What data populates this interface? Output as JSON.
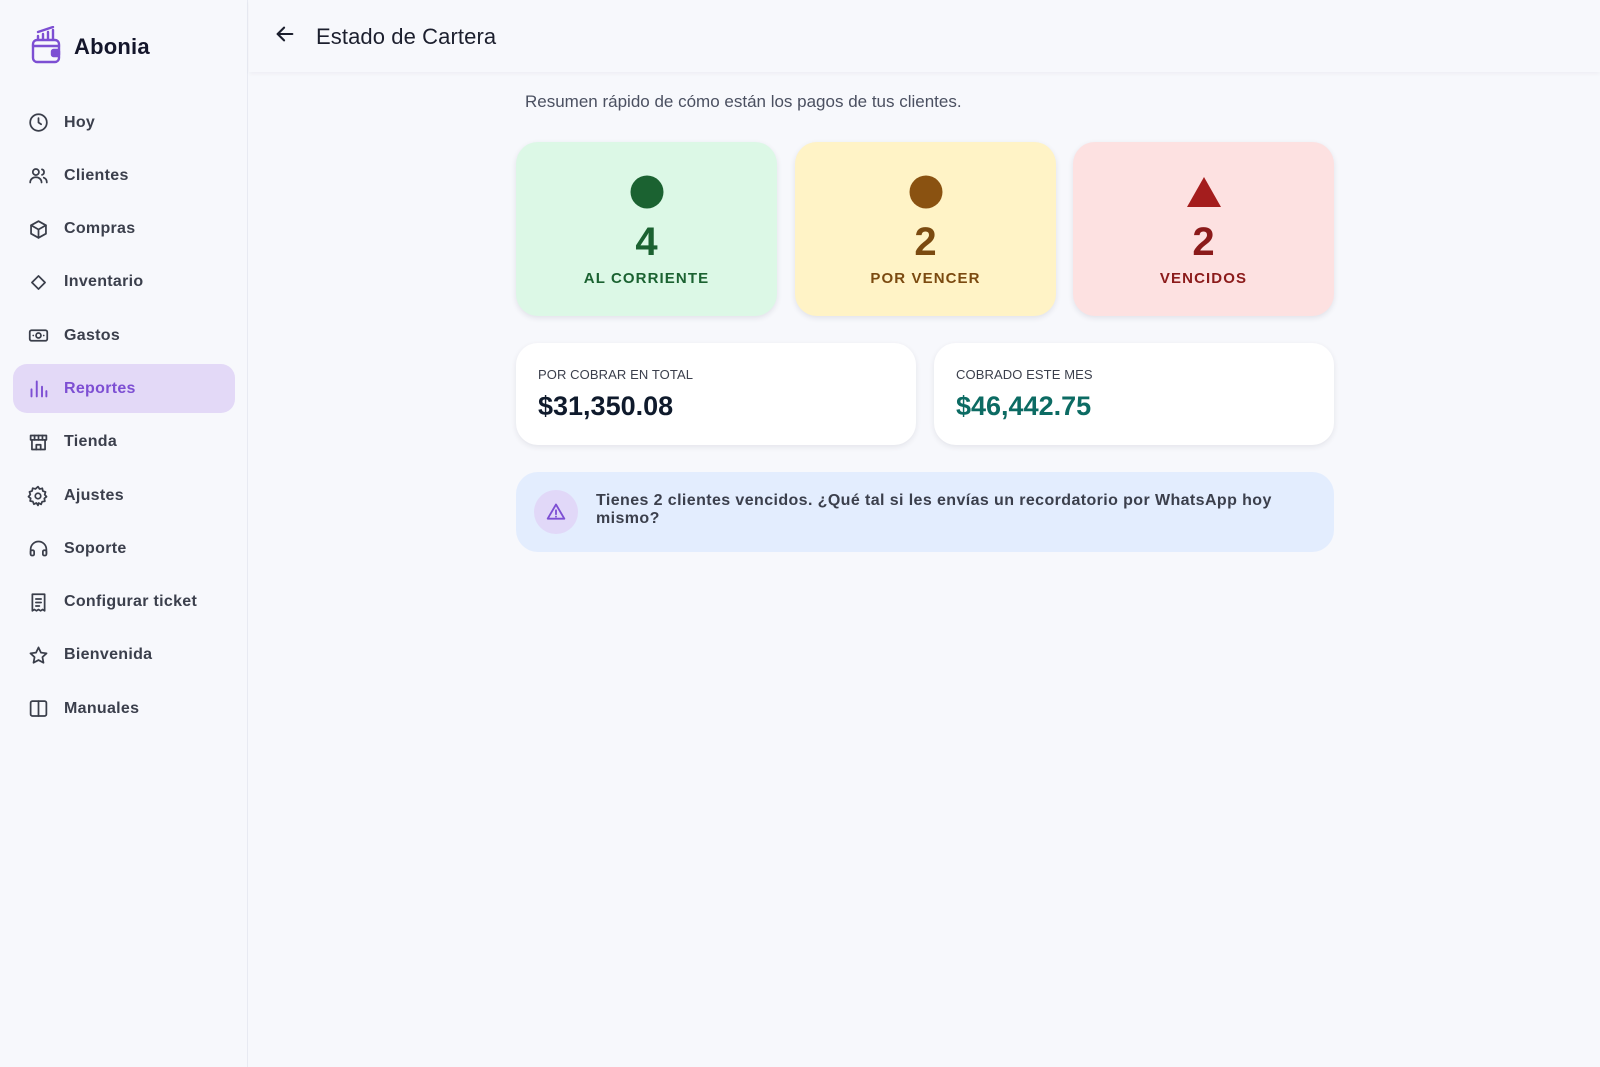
{
  "brand": {
    "name": "Abonia"
  },
  "sidebar": {
    "items": [
      {
        "label": "Hoy",
        "icon": "clock-icon",
        "active": false
      },
      {
        "label": "Clientes",
        "icon": "users-icon",
        "active": false
      },
      {
        "label": "Compras",
        "icon": "box-icon",
        "active": false
      },
      {
        "label": "Inventario",
        "icon": "diamond-icon",
        "active": false
      },
      {
        "label": "Gastos",
        "icon": "banknote-icon",
        "active": false
      },
      {
        "label": "Reportes",
        "icon": "bar-chart-icon",
        "active": true
      },
      {
        "label": "Tienda",
        "icon": "store-icon",
        "active": false
      },
      {
        "label": "Ajustes",
        "icon": "gear-icon",
        "active": false
      },
      {
        "label": "Soporte",
        "icon": "headphones-icon",
        "active": false
      },
      {
        "label": "Configurar ticket",
        "icon": "receipt-icon",
        "active": false
      },
      {
        "label": "Bienvenida",
        "icon": "star-icon",
        "active": false
      },
      {
        "label": "Manuales",
        "icon": "book-icon",
        "active": false
      }
    ]
  },
  "header": {
    "title": "Estado de Cartera",
    "back_icon": "arrow-left-icon"
  },
  "main": {
    "subtitle": "Resumen rápido de cómo están los pagos de tus clientes.",
    "status_cards": [
      {
        "count": "4",
        "caption": "AL CORRIENTE",
        "symbol": "circle",
        "color": "#1b6231",
        "bg": "#dcf8e6"
      },
      {
        "count": "2",
        "caption": "POR VENCER",
        "symbol": "circle",
        "color": "#7b4a10",
        "bg": "#fff3c6"
      },
      {
        "count": "2",
        "caption": "VENCIDOS",
        "symbol": "triangle",
        "color": "#8b1a1a",
        "bg": "#fde1e1"
      }
    ],
    "totals": {
      "por_cobrar": {
        "label": "POR COBRAR EN TOTAL",
        "value": "$31,350.08"
      },
      "cobrado": {
        "label": "COBRADO ESTE MES",
        "value": "$46,442.75"
      }
    },
    "alert": {
      "icon": "warning-icon",
      "text": "Tienes 2 clientes vencidos. ¿Qué tal si les envías un recordatorio por WhatsApp hoy mismo?"
    }
  },
  "colors": {
    "accent": "#7d4fd3",
    "active_bg": "#e3d9f7",
    "alert_bg": "#e3edfe"
  }
}
